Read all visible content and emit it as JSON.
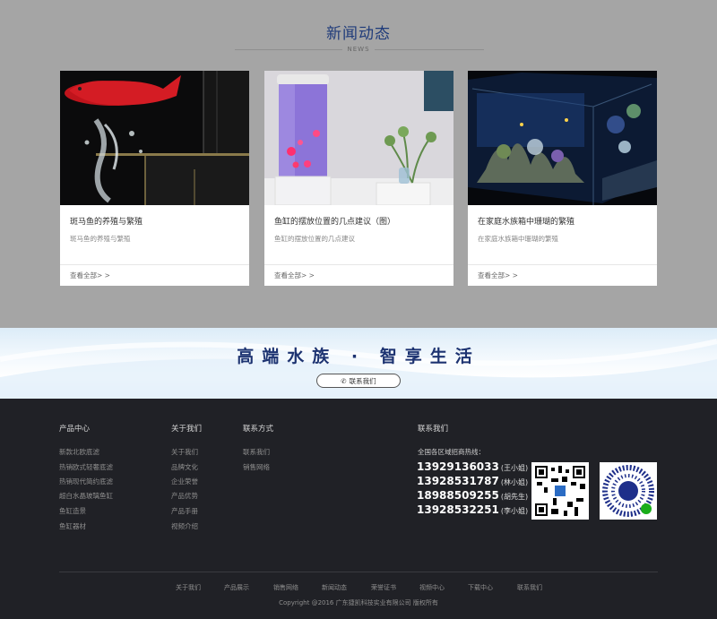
{
  "news": {
    "title": "新闻动态",
    "subtitle": "NEWS",
    "cards": [
      {
        "title": "斑马鱼的养殖与繁殖",
        "desc": "斑马鱼的养殖与繁殖",
        "more": "查看全部> >"
      },
      {
        "title": "鱼缸的摆放位置的几点建议（图）",
        "desc": "鱼缸的摆放位置的几点建议",
        "more": "查看全部> >"
      },
      {
        "title": "在家庭水族箱中珊瑚的繁殖",
        "desc": "在家庭水族箱中珊瑚的繁殖",
        "more": "查看全部> >"
      }
    ]
  },
  "banner": {
    "slogan": "高端水族 · 智享生活",
    "contact_button": "联系我们"
  },
  "footer": {
    "columns": [
      {
        "title": "产品中心",
        "items": [
          "新款北欧底滤",
          "热销欧式轻奢底滤",
          "热销现代简约底滤",
          "超白水晶玻璃鱼缸",
          "鱼缸造景",
          "鱼缸器材"
        ]
      },
      {
        "title": "关于我们",
        "items": [
          "关于我们",
          "品牌文化",
          "企业荣誉",
          "产品优势",
          "产品手册",
          "视频介绍"
        ]
      },
      {
        "title": "联系方式",
        "items": [
          "联系我们",
          "销售网络"
        ]
      }
    ],
    "contact": {
      "title": "联系我们",
      "hotline_label": "全国各区域招商热线：",
      "phones": [
        {
          "number": "13929136033",
          "person": "(王小姐)"
        },
        {
          "number": "13928531787",
          "person": "(林小姐)"
        },
        {
          "number": "18988509255",
          "person": "(胡先生)"
        },
        {
          "number": "13928532251",
          "person": "(李小姐)"
        }
      ]
    },
    "bottom_nav": [
      "关于我们",
      "产品展示",
      "销售网络",
      "新闻动态",
      "荣誉证书",
      "视频中心",
      "下载中心",
      "联系我们"
    ],
    "copyright": "Copyright @2016 广东捷凯科技实业有限公司 版权所有"
  },
  "colors": {
    "accent": "#1f3b7a",
    "footer_bg": "#202126",
    "news_bg": "#a5a5a5"
  }
}
